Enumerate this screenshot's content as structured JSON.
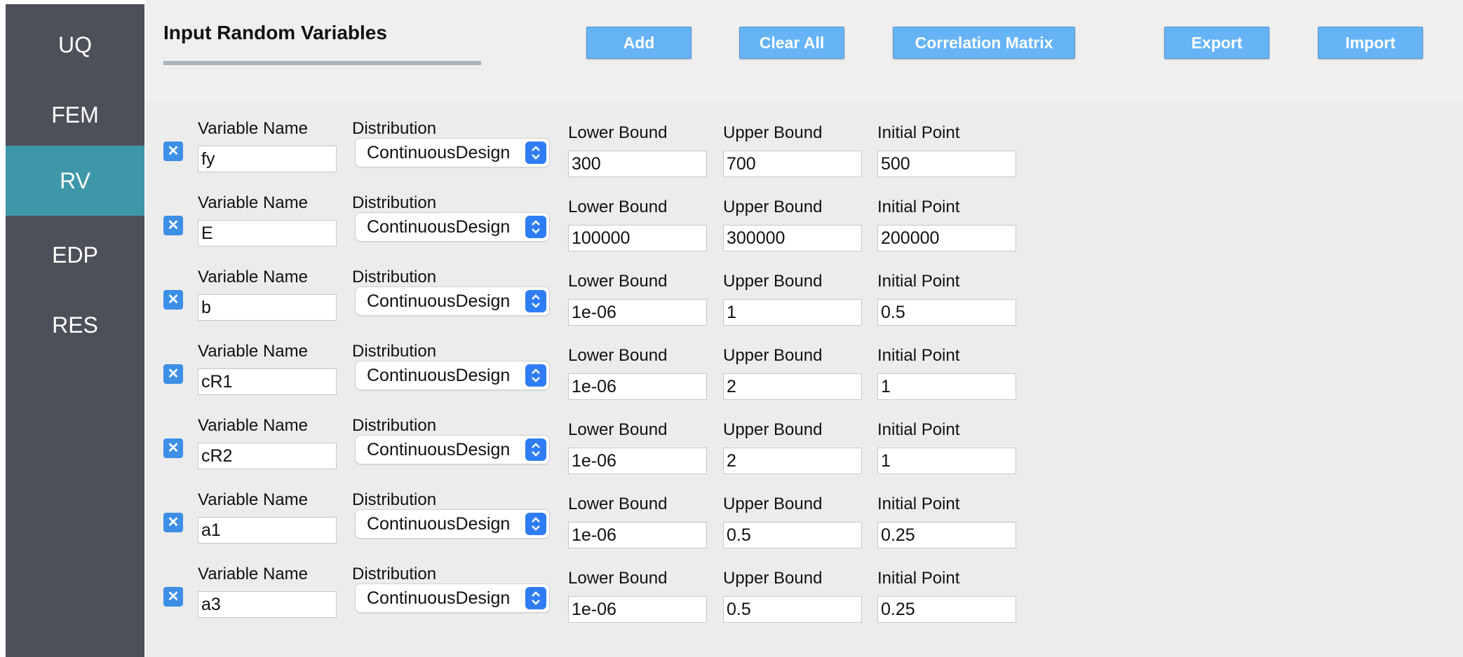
{
  "sidebar": {
    "items": [
      {
        "label": "UQ"
      },
      {
        "label": "FEM"
      },
      {
        "label": "RV",
        "active": true
      },
      {
        "label": "EDP"
      },
      {
        "label": "RES"
      }
    ]
  },
  "header": {
    "title": "Input Random Variables",
    "buttons": {
      "add": "Add",
      "clear_all": "Clear All",
      "correlation_matrix": "Correlation Matrix",
      "export": "Export",
      "import": "Import"
    }
  },
  "labels": {
    "variable_name": "Variable Name",
    "distribution": "Distribution",
    "lower_bound": "Lower Bound",
    "upper_bound": "Upper Bound",
    "initial_point": "Initial Point"
  },
  "variables": [
    {
      "name": "fy",
      "distribution": "ContinuousDesign",
      "lower": "300",
      "upper": "700",
      "initial": "500"
    },
    {
      "name": "E",
      "distribution": "ContinuousDesign",
      "lower": "100000",
      "upper": "300000",
      "initial": "200000"
    },
    {
      "name": "b",
      "distribution": "ContinuousDesign",
      "lower": "1e-06",
      "upper": "1",
      "initial": "0.5"
    },
    {
      "name": "cR1",
      "distribution": "ContinuousDesign",
      "lower": "1e-06",
      "upper": "2",
      "initial": "1"
    },
    {
      "name": "cR2",
      "distribution": "ContinuousDesign",
      "lower": "1e-06",
      "upper": "2",
      "initial": "1"
    },
    {
      "name": "a1",
      "distribution": "ContinuousDesign",
      "lower": "1e-06",
      "upper": "0.5",
      "initial": "0.25"
    },
    {
      "name": "a3",
      "distribution": "ContinuousDesign",
      "lower": "1e-06",
      "upper": "0.5",
      "initial": "0.25"
    }
  ],
  "colors": {
    "sidebar": "#4d5058",
    "sidebar_active": "#3e96a9",
    "button": "#66b3f6",
    "checkbox": "#3d8fe6",
    "select_arrow": "#2f7df6"
  }
}
